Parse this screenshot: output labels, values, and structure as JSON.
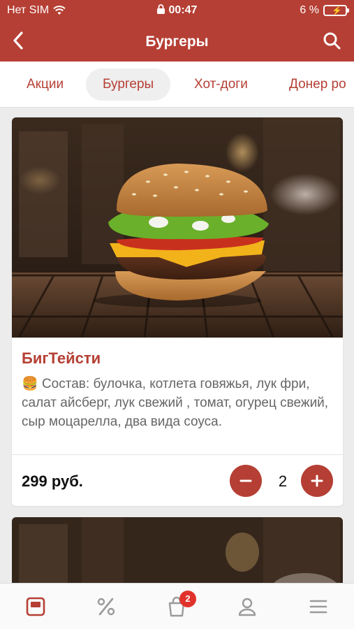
{
  "status_bar": {
    "carrier": "Нет SIM",
    "time": "00:47",
    "battery": "6 %"
  },
  "nav": {
    "title": "Бургеры"
  },
  "tabs": [
    {
      "label": "Акции",
      "active": false
    },
    {
      "label": "Бургеры",
      "active": true
    },
    {
      "label": "Хот-доги",
      "active": false
    },
    {
      "label": "Донер ро",
      "active": false
    }
  ],
  "product": {
    "name": "БигТейсти",
    "emoji": "🍔",
    "description": "Состав: булочка, котлета говяжья, лук фри, салат айсберг, лук свежий , томат, огурец свежий, сыр моцарелла, два вида соуса.",
    "price": "299 руб.",
    "quantity": "2"
  },
  "bottom_nav": {
    "cart_badge": "2"
  },
  "colors": {
    "brand": "#b53f34",
    "badge": "#e0322b"
  }
}
